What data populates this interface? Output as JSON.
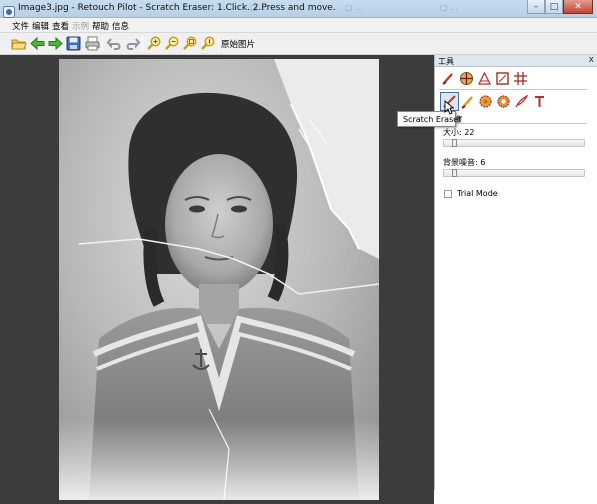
{
  "window": {
    "title": "Image3.jpg - Retouch Pilot - Scratch Eraser: 1.Click. 2.Press and move.",
    "ghost_tabs": [
      "▢ ...",
      "▢ ...",
      "▢ ..."
    ],
    "controls": {
      "minimize": "–",
      "maximize": "□",
      "close": "✕"
    }
  },
  "menubar": {
    "items": [
      {
        "label": "文件",
        "enabled": true
      },
      {
        "label": "编辑",
        "enabled": true
      },
      {
        "label": "查看",
        "enabled": true
      },
      {
        "label": "示例",
        "enabled": false
      },
      {
        "label": "帮助",
        "enabled": true
      },
      {
        "label": "信息",
        "enabled": true
      }
    ]
  },
  "toolbar": {
    "icons": [
      "open-folder-icon",
      "back-arrow-icon",
      "forward-arrow-icon",
      "save-disk-icon",
      "print-icon",
      "undo-icon",
      "redo-icon",
      "zoom-in-icon",
      "zoom-out-icon",
      "zoom-fit-icon",
      "zoom-actual-icon"
    ],
    "original_image_label": "原始图片"
  },
  "panel": {
    "title": "工具",
    "close": "x",
    "tools_row1": [
      "brush-tool-icon",
      "color-tool-icon",
      "perspective-tool-icon",
      "crop-tool-icon",
      "grid-tool-icon"
    ],
    "tools_row2": [
      "scratch-eraser-icon",
      "brush-eraser-icon",
      "flower-stamp-icon",
      "gear-stamp-icon",
      "feather-tool-icon",
      "text-tool-icon"
    ],
    "section_label": "Scratch Eraser",
    "section_title_fragment": "擦",
    "size_label": "大小: 22",
    "size_value": 22,
    "bg_noise_label": "背景噪音: 6",
    "bg_noise_value": 6,
    "trial_mode_label": "Trial Mode",
    "trial_mode_checked": false
  },
  "tooltip": {
    "text": "Scratch Eraser"
  },
  "photo": {
    "subject": "vintage-portrait-girl-sailor-collar",
    "tone": "grayscale-sepia"
  },
  "colors": {
    "title_bar": "#c0d6ec",
    "canvas_bg": "#3c3c3c",
    "panel_header": "#dfe6ee",
    "close_button": "#c3432f"
  }
}
